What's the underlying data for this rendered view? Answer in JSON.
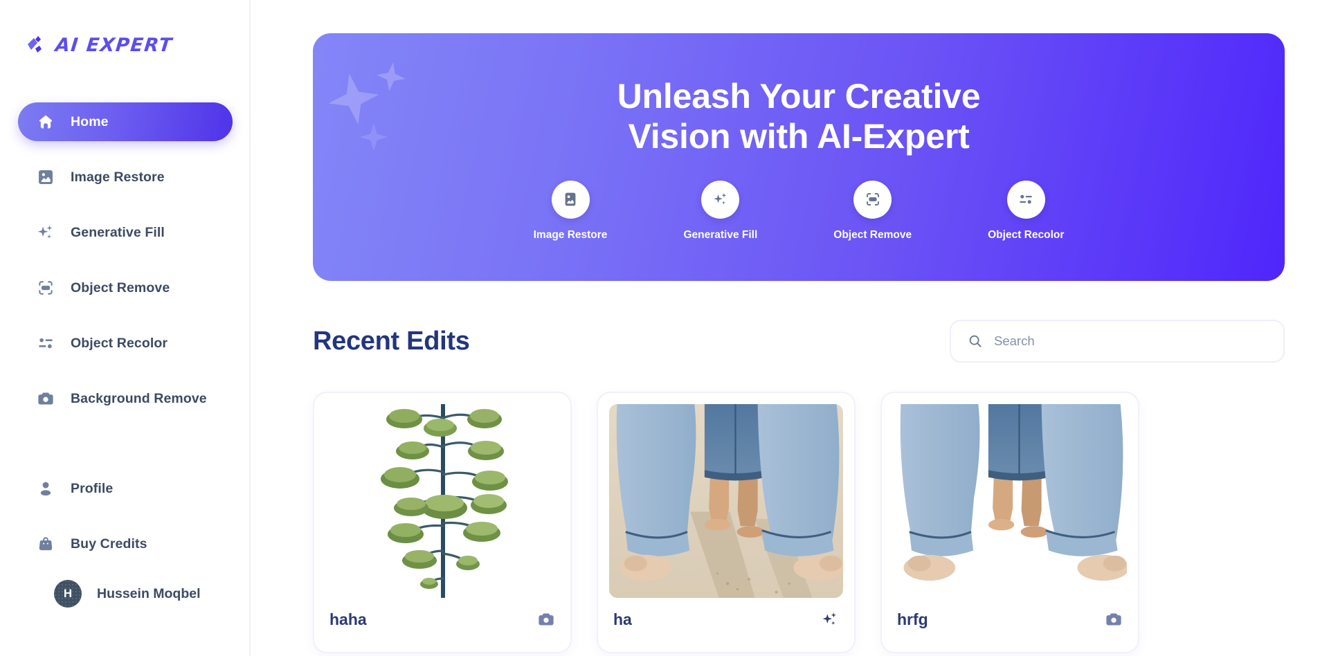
{
  "brand": {
    "name": "AI EXPERT",
    "logo_icon": "sparkle-logo-icon",
    "accent": "#5b4df0"
  },
  "sidebar": {
    "items": [
      {
        "label": "Home",
        "icon": "home-icon",
        "active": true
      },
      {
        "label": "Image Restore",
        "icon": "image-restore-icon",
        "active": false
      },
      {
        "label": "Generative Fill",
        "icon": "sparkles-icon",
        "active": false
      },
      {
        "label": "Object Remove",
        "icon": "object-remove-icon",
        "active": false
      },
      {
        "label": "Object Recolor",
        "icon": "object-recolor-icon",
        "active": false
      },
      {
        "label": "Background Remove",
        "icon": "camera-icon",
        "active": false
      }
    ],
    "account_items": [
      {
        "label": "Profile",
        "icon": "person-icon"
      },
      {
        "label": "Buy Credits",
        "icon": "bag-icon"
      }
    ],
    "user": {
      "name": "Hussein Moqbel",
      "initial": "H",
      "avatar_color": "#3f5163"
    }
  },
  "hero": {
    "title_line1": "Unleash Your Creative",
    "title_line2": "Vision with AI-Expert",
    "gradient_from": "#8486f7",
    "gradient_to": "#4f26fb",
    "actions": [
      {
        "label": "Image Restore",
        "icon": "image-restore-icon"
      },
      {
        "label": "Generative Fill",
        "icon": "sparkles-icon"
      },
      {
        "label": "Object Remove",
        "icon": "object-remove-icon"
      },
      {
        "label": "Object Recolor",
        "icon": "object-recolor-icon"
      }
    ]
  },
  "main": {
    "section_title": "Recent Edits",
    "search": {
      "placeholder": "Search",
      "value": "",
      "icon": "search-icon"
    },
    "cards": [
      {
        "title": "haha",
        "icon": "camera-icon",
        "media": "agave-flower-stalk-on-white"
      },
      {
        "title": "ha",
        "icon": "sparkles-icon",
        "media": "legs-in-jeans-on-sand-beach"
      },
      {
        "title": "hrfg",
        "icon": "camera-icon",
        "media": "legs-in-jeans-background-removed"
      }
    ]
  }
}
